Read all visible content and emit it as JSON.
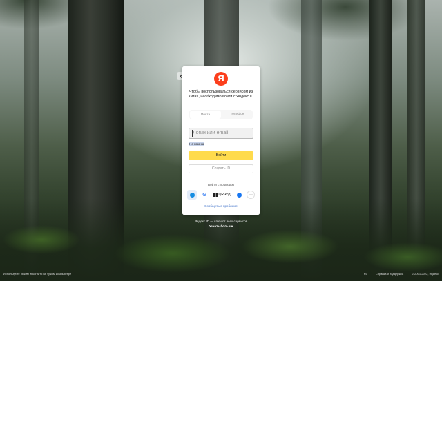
{
  "background": {
    "scene": "misty forest"
  },
  "back_button": {
    "icon": "arrow-left-icon"
  },
  "card": {
    "logo": "Я",
    "message": "Чтобы воспользоваться сервисом из Китая, необходимо войти с Яндекс ID",
    "tabs": [
      "Почта",
      "Телефон"
    ],
    "login_placeholder": "Логин или email",
    "remember_label": "Не помню",
    "login_button": "Войти",
    "create_button": "Создать ID",
    "via_label": "Войти с помощью",
    "social": {
      "mail_icon": "mail-ru-icon",
      "google_icon": "google-icon",
      "google_glyph": "G",
      "qr_label": "QR-код",
      "facebook_icon": "facebook-icon",
      "more_icon": "more-icon",
      "more_glyph": "···"
    },
    "report_link": "Сообщить о проблеме"
  },
  "below_card": {
    "line1": "Яндекс ID — ключ от всех сервисов",
    "more_link": "Узнать больше"
  },
  "footer": {
    "left": "Используйте режим инкогнито на чужом компьютере",
    "lang": "Ru",
    "help": "Справка и поддержка",
    "copyright": "© 2001-2022, Яндекс"
  },
  "colors": {
    "brand_red": "#fc3f1d",
    "button_yellow": "#ffdb4d",
    "link_blue": "#4374c9"
  }
}
